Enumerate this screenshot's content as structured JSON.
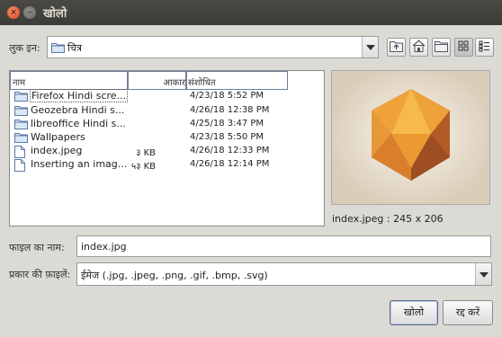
{
  "window": {
    "title": "खोलो"
  },
  "look_in": {
    "label": "लुक इन:",
    "value": "चित्र"
  },
  "columns": {
    "name": "नाम",
    "size": "आकार",
    "modified": "संशोधित"
  },
  "files": [
    {
      "name": "Firefox Hindi scre...",
      "size": "",
      "modified": "4/23/18 5:52 PM",
      "type": "folder",
      "selected": true
    },
    {
      "name": "Geozebra Hindi s...",
      "size": "",
      "modified": "4/26/18 12:38 PM",
      "type": "folder"
    },
    {
      "name": "libreoffice Hindi s...",
      "size": "",
      "modified": "4/25/18 3:47 PM",
      "type": "folder"
    },
    {
      "name": "Wallpapers",
      "size": "",
      "modified": "4/23/18 5:50 PM",
      "type": "folder"
    },
    {
      "name": "index.jpeg",
      "size": "३ KB",
      "modified": "4/26/18 12:33 PM",
      "type": "file"
    },
    {
      "name": "Inserting an imag...",
      "size": "५३ KB",
      "modified": "4/26/18 12:14 PM",
      "type": "file"
    }
  ],
  "preview": {
    "caption": "index.jpeg : 245 x 206"
  },
  "filename": {
    "label": "फाइल का नाम:",
    "value": "index.jpg"
  },
  "filetype": {
    "label": "प्रकार की फ़ाइलें:",
    "value": "ईमेज (.jpg, .jpeg, .png, .gif, .bmp, .svg)"
  },
  "buttons": {
    "open": "खोलो",
    "cancel": "रद्द करें"
  },
  "toolbar": [
    "up-folder-icon",
    "home-icon",
    "new-folder-icon",
    "list-view-icon",
    "details-view-icon"
  ]
}
